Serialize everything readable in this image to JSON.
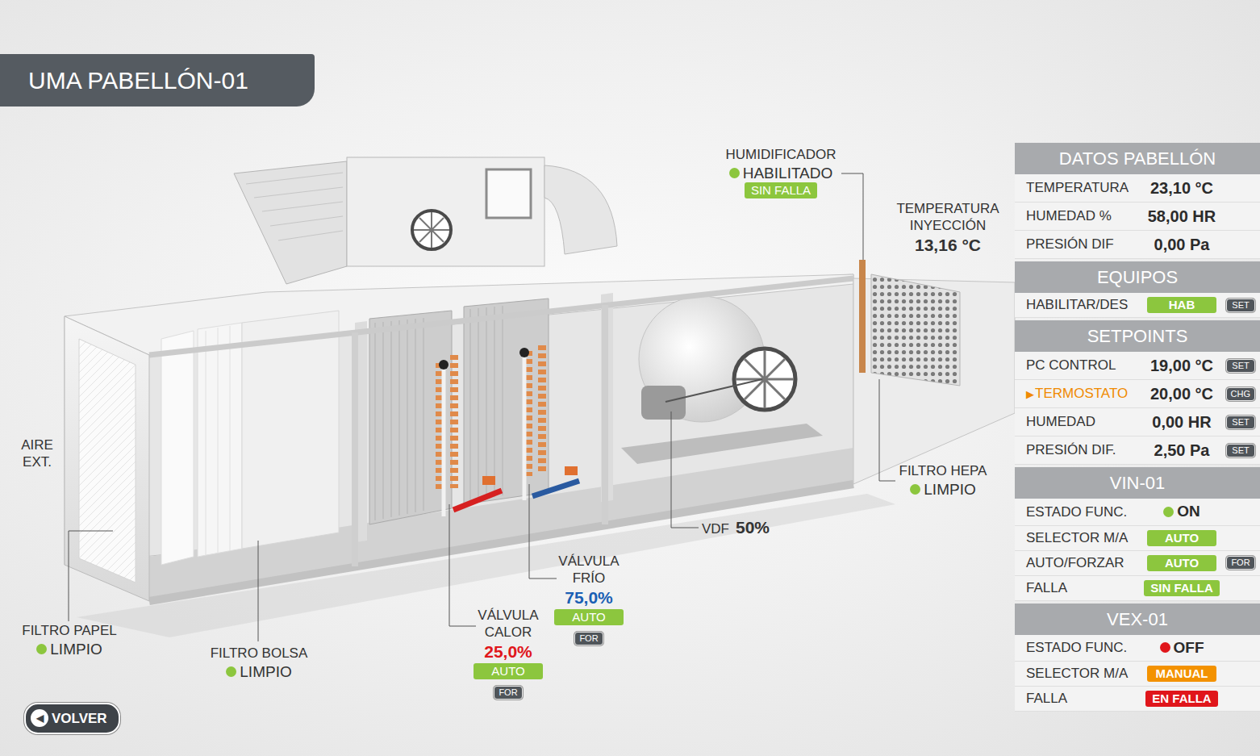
{
  "title": "UMA PABELLÓN-01",
  "back": {
    "icon": "◀",
    "label": "VOLVER"
  },
  "diagram": {
    "callouts": [
      {
        "kind": "status",
        "lines": [
          "HUMIDIFICADOR"
        ],
        "status": {
          "text": "HABILITADO",
          "color": "#8cc63e"
        },
        "badge": {
          "text": "SIN FALLA",
          "color": "#8cc63e"
        }
      },
      {
        "kind": "reading",
        "lines": [
          "TEMPERATURA",
          "INYECCIÓN"
        ],
        "value": "13,16 °C"
      },
      {
        "kind": "label",
        "lines": [
          "AIRE",
          "EXT."
        ]
      },
      {
        "kind": "status",
        "lines": [
          "FILTRO HEPA"
        ],
        "status": {
          "text": "LIMPIO",
          "color": "#8cc63e"
        }
      },
      {
        "kind": "inline",
        "lines": [
          "VDF"
        ],
        "value": "50%"
      },
      {
        "kind": "valve",
        "lines": [
          "VÁLVULA",
          "FRÍO"
        ],
        "value": {
          "text": "75,0%",
          "color": "#1a5fb4"
        },
        "badge": {
          "text": "AUTO",
          "color": "#8cc63e"
        },
        "button": "FOR"
      },
      {
        "kind": "valve",
        "lines": [
          "VÁLVULA",
          "CALOR"
        ],
        "value": {
          "text": "25,0%",
          "color": "#e0161b"
        },
        "badge": {
          "text": "AUTO",
          "color": "#8cc63e"
        },
        "button": "FOR"
      },
      {
        "kind": "status",
        "lines": [
          "FILTRO PAPEL"
        ],
        "status": {
          "text": "LIMPIO",
          "color": "#8cc63e"
        }
      },
      {
        "kind": "status",
        "lines": [
          "FILTRO BOLSA"
        ],
        "status": {
          "text": "LIMPIO",
          "color": "#8cc63e"
        }
      }
    ]
  },
  "panel": {
    "sections": [
      {
        "title": "DATOS PABELLÓN",
        "rows": [
          {
            "kind": "value",
            "label": "TEMPERATURA",
            "value": "23,10 °C"
          },
          {
            "kind": "value",
            "label": "HUMEDAD %",
            "value": "58,00 HR"
          },
          {
            "kind": "value",
            "label": "PRESIÓN DIF",
            "value": "0,00 Pa"
          }
        ]
      },
      {
        "title": "EQUIPOS",
        "rows": [
          {
            "kind": "badge",
            "label": "HABILITAR/DES",
            "badge": {
              "text": "HAB",
              "color": "#8cc63e"
            },
            "button": "SET"
          }
        ]
      },
      {
        "title": "SETPOINTS",
        "pointer": "▶",
        "rows": [
          {
            "kind": "value",
            "label": "PC CONTROL",
            "value": "19,00 °C",
            "button": "SET",
            "selected": false
          },
          {
            "kind": "value",
            "label": "TERMOSTATO",
            "value": "20,00 °C",
            "button": "CHG",
            "selected": true
          },
          {
            "kind": "value",
            "label": "HUMEDAD",
            "value": "0,00 HR",
            "button": "SET",
            "selected": false
          },
          {
            "kind": "value",
            "label": "PRESIÓN DIF.",
            "value": "2,50 Pa",
            "button": "SET",
            "selected": false
          }
        ]
      },
      {
        "title": "VIN-01",
        "rows": [
          {
            "kind": "status",
            "label": "ESTADO FUNC.",
            "status": {
              "text": "ON",
              "color": "#8cc63e"
            }
          },
          {
            "kind": "badge",
            "label": "SELECTOR M/A",
            "badge": {
              "text": "AUTO",
              "color": "#8cc63e"
            }
          },
          {
            "kind": "badge",
            "label": "AUTO/FORZAR",
            "badge": {
              "text": "AUTO",
              "color": "#8cc63e"
            },
            "button": "FOR"
          },
          {
            "kind": "badge",
            "label": "FALLA",
            "badge": {
              "text": "SIN FALLA",
              "color": "#8cc63e"
            }
          }
        ]
      },
      {
        "title": "VEX-01",
        "rows": [
          {
            "kind": "status",
            "label": "ESTADO FUNC.",
            "status": {
              "text": "OFF",
              "color": "#e0161b"
            }
          },
          {
            "kind": "badge",
            "label": "SELECTOR M/A",
            "badge": {
              "text": "MANUAL",
              "color": "#f39200"
            }
          },
          {
            "kind": "badge",
            "label": "FALLA",
            "badge": {
              "text": "EN FALLA",
              "color": "#e0161b"
            }
          }
        ]
      }
    ]
  }
}
